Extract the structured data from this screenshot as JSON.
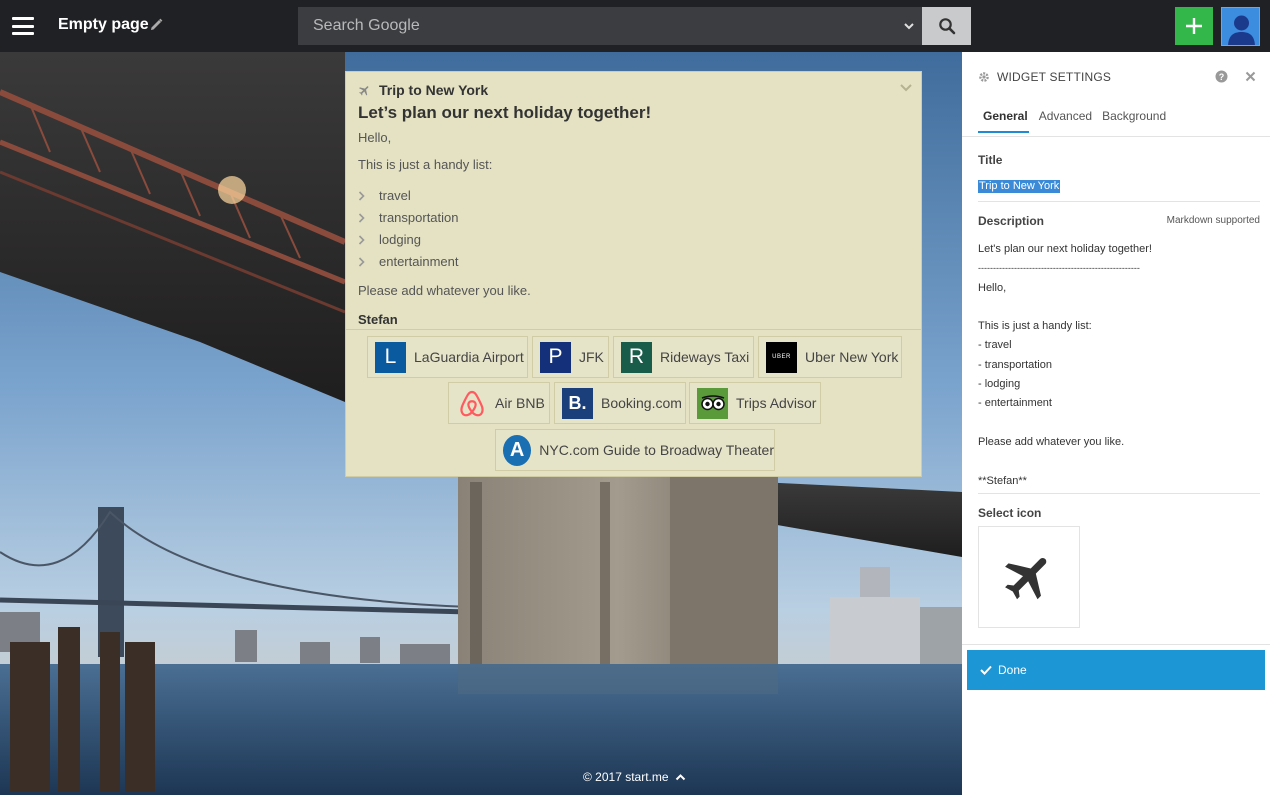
{
  "topbar": {
    "page_title": "Empty page",
    "search_placeholder": "Search Google"
  },
  "widget": {
    "title": "Trip to New York",
    "icon": "airplane-icon",
    "heading": "Let’s plan our next holiday together!",
    "greeting": "Hello,",
    "intro": "This is just a handy list:",
    "list": [
      "travel",
      "transportation",
      "lodging",
      "entertainment"
    ],
    "closing": "Please add whatever you like.",
    "signature": "Stefan",
    "links": [
      {
        "label": "LaGuardia Airport",
        "glyph": "L",
        "bg": "#0a5aa0",
        "fg": "#ffffff"
      },
      {
        "label": "JFK",
        "glyph": "P",
        "bg": "#14307a",
        "fg": "#ffffff"
      },
      {
        "label": "Rideways Taxi",
        "glyph": "R",
        "bg": "#1a5c4a",
        "fg": "#ffffff"
      },
      {
        "label": "Uber New York",
        "glyph": "UBER",
        "bg": "#000000",
        "fg": "#ffffff"
      },
      {
        "label": "Air BNB",
        "glyph": "airbnb-logo",
        "bg": "#e4e2c3",
        "fg": "#ff5a5f"
      },
      {
        "label": "Booking.com",
        "glyph": "B.",
        "bg": "#1b3f7a",
        "fg": "#ffffff"
      },
      {
        "label": "Trips Advisor",
        "glyph": "owl-logo",
        "bg": "#5a9a3a",
        "fg": "#ffffff"
      },
      {
        "label": "NYC.com Guide to Broadway Theater",
        "glyph": "A",
        "bg": "#1a6fb3",
        "fg": "#ffffff"
      }
    ]
  },
  "footer": {
    "text": "© 2017 start.me"
  },
  "settings": {
    "header": "WIDGET SETTINGS",
    "tabs": [
      {
        "label": "General",
        "active": true
      },
      {
        "label": "Advanced",
        "active": false
      },
      {
        "label": "Background",
        "active": false
      }
    ],
    "title_label": "Title",
    "title_value": "Trip to New York",
    "description_label": "Description",
    "markdown_hint": "Markdown supported",
    "description_lines": [
      "Let's plan our next holiday together!",
      "------------------------------------------------------",
      "Hello,",
      "",
      "This is just a handy list:",
      "- travel",
      "- transportation",
      "- lodging",
      "- entertainment",
      "",
      "Please add whatever you like.",
      "",
      "**Stefan**"
    ],
    "select_icon_label": "Select icon",
    "selected_icon": "airplane-icon",
    "done_label": "Done"
  },
  "colors": {
    "topbar_bg": "#202124",
    "add_button": "#33b64a",
    "widget_bg": "#e4e2c3",
    "accent": "#1d96d6",
    "selection": "#3a8ad8"
  }
}
